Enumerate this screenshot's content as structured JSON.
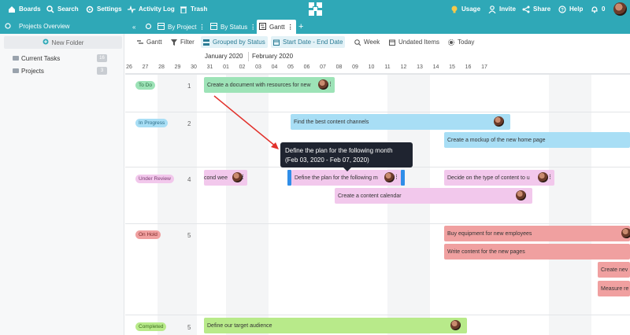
{
  "topbar": {
    "boards": "Boards",
    "search": "Search",
    "settings": "Settings",
    "activity_log": "Activity Log",
    "trash": "Trash",
    "usage": "Usage",
    "invite": "Invite",
    "share": "Share",
    "help": "Help",
    "notifications_count": "0"
  },
  "sidebar": {
    "title": "Projects Overview",
    "new_folder": "New Folder",
    "folders": [
      {
        "label": "Current Tasks",
        "count": "16"
      },
      {
        "label": "Projects",
        "count": "3"
      }
    ]
  },
  "tabs": [
    {
      "label": "By Project"
    },
    {
      "label": "By Status"
    },
    {
      "label": "Gantt"
    }
  ],
  "toolbar": {
    "gantt": "Gantt",
    "filter": "Filter",
    "grouped": "Grouped by Status",
    "dates": "Start Date - End Date",
    "week": "Week",
    "undated": "Undated Items",
    "today": "Today"
  },
  "timeline": {
    "months": [
      "January 2020",
      "February 2020"
    ],
    "days": [
      "26",
      "27",
      "28",
      "29",
      "30",
      "31",
      "01",
      "02",
      "03",
      "04",
      "05",
      "06",
      "07",
      "08",
      "09",
      "10",
      "11",
      "12",
      "13",
      "14",
      "15",
      "16",
      "17"
    ]
  },
  "groups": [
    {
      "status": "To Do",
      "count": "1"
    },
    {
      "status": "In Progress",
      "count": "2"
    },
    {
      "status": "Under Review",
      "count": "4"
    },
    {
      "status": "On Hold",
      "count": "5"
    },
    {
      "status": "Completed",
      "count": "5"
    }
  ],
  "tasks": [
    {
      "label": "Create a document with resources for new"
    },
    {
      "label": "Find the best content channels"
    },
    {
      "label": "Create a mockup of the new home page"
    },
    {
      "label": "cond wee"
    },
    {
      "label": "Define the plan for the following m"
    },
    {
      "label": "Decide on the type of content to u"
    },
    {
      "label": "Create a content calendar"
    },
    {
      "label": "Buy equipment for new employees"
    },
    {
      "label": "Write content for the new pages"
    },
    {
      "label": "Create nev"
    },
    {
      "label": "Measure re"
    },
    {
      "label": "Define our target audience"
    }
  ],
  "tooltip": {
    "line1": "Define the plan for the following month",
    "line2": "(Feb 03, 2020 - Feb 07, 2020)"
  },
  "colors": {
    "accent": "#2fa8b7",
    "todo": "#9de3b7",
    "in_progress": "#a8def5",
    "under_review": "#f2c8ec",
    "on_hold": "#f0a0a0",
    "completed": "#b8ea8a"
  }
}
